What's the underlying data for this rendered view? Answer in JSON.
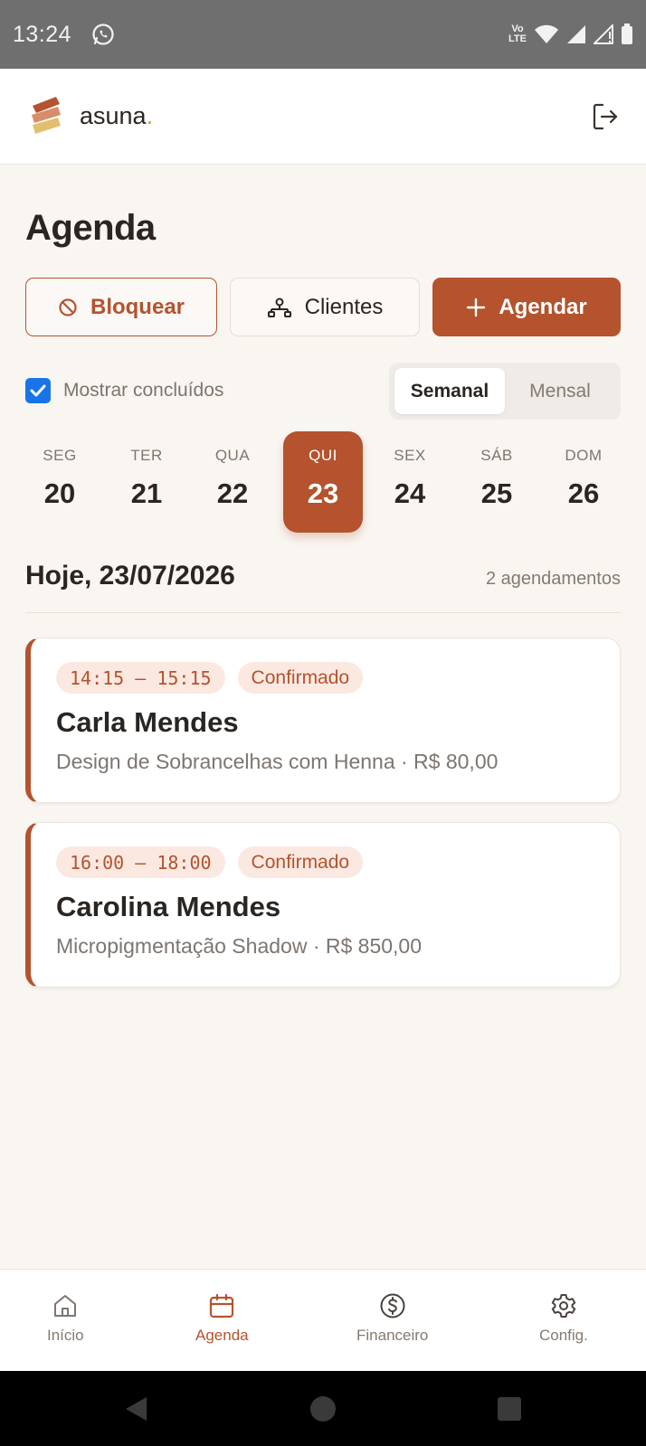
{
  "status_bar": {
    "time": "13:24",
    "volte_top": "Vo",
    "volte_bottom": "LTE"
  },
  "app": {
    "brand": "asuna",
    "brand_dot": ".",
    "colors": {
      "accent": "#b4532e",
      "tag_bg": "#fbe9e1",
      "background": "#f9f6f2"
    }
  },
  "page": {
    "title": "Agenda"
  },
  "actions": {
    "block": "Bloquear",
    "clients": "Clientes",
    "schedule": "Agendar"
  },
  "filters": {
    "show_completed_label": "Mostrar concluídos",
    "show_completed_checked": true,
    "view_weekly": "Semanal",
    "view_monthly": "Mensal",
    "selected_view": "Semanal"
  },
  "week": {
    "days": [
      {
        "dow": "SEG",
        "num": "20"
      },
      {
        "dow": "TER",
        "num": "21"
      },
      {
        "dow": "QUA",
        "num": "22"
      },
      {
        "dow": "QUI",
        "num": "23"
      },
      {
        "dow": "SEX",
        "num": "24"
      },
      {
        "dow": "SÁB",
        "num": "25"
      },
      {
        "dow": "DOM",
        "num": "26"
      }
    ],
    "selected": "23"
  },
  "today": {
    "title": "Hoje, 23/07/2026",
    "count": "2 agendamentos"
  },
  "appointments": [
    {
      "time": "14:15 – 15:15",
      "status": "Confirmado",
      "client": "Carla Mendes",
      "detail": "Design de Sobrancelhas com Henna · R$ 80,00"
    },
    {
      "time": "16:00 – 18:00",
      "status": "Confirmado",
      "client": "Carolina Mendes",
      "detail": "Micropigmentação Shadow · R$ 850,00"
    }
  ],
  "nav": {
    "home": "Início",
    "agenda": "Agenda",
    "finance": "Financeiro",
    "settings": "Config.",
    "active": "Agenda"
  }
}
